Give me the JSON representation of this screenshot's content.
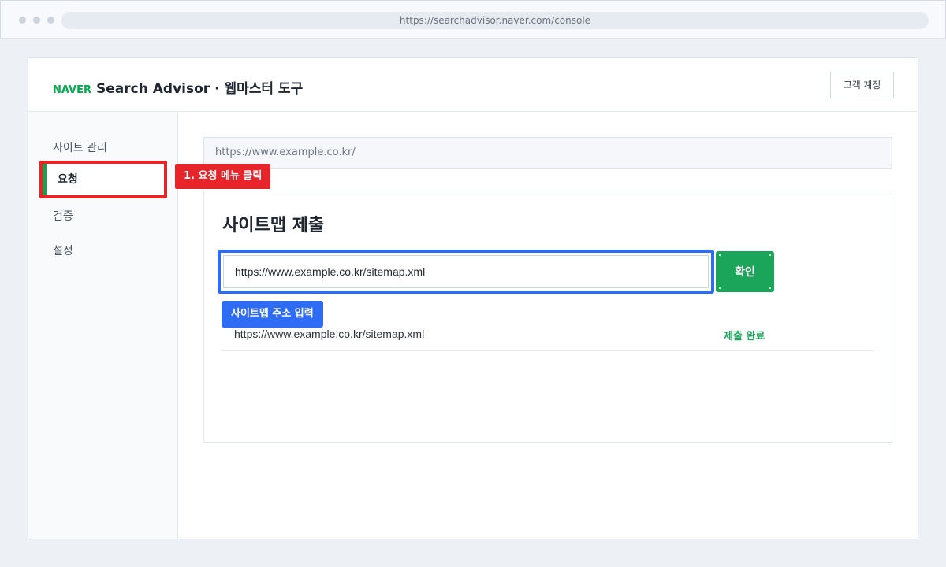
{
  "browser": {
    "url": "https://searchadvisor.naver.com/console"
  },
  "header": {
    "brand": "NAVER",
    "title": "Search Advisor · 웹마스터 도구",
    "account_button": "고객 계정"
  },
  "sidebar": {
    "items": [
      {
        "label": "사이트 관리"
      },
      {
        "label": "요청"
      },
      {
        "label": "검증"
      },
      {
        "label": "설정"
      }
    ],
    "active_index": 1
  },
  "annotations": {
    "step1": "1. 요청 메뉴 클릭",
    "input_hint": "사이트맵 주소 입력"
  },
  "main": {
    "site_url": "https://www.example.co.kr/",
    "card_title": "사이트맵 제출",
    "sitemap_input_value": "https://www.example.co.kr/sitemap.xml",
    "confirm_button": "확인",
    "results": [
      {
        "url": "https://www.example.co.kr/sitemap.xml",
        "status": "제출 완료"
      }
    ]
  },
  "colors": {
    "naver_green": "#03a94f",
    "button_green": "#1ba55a",
    "highlight_red": "#e8242b",
    "highlight_blue": "#2f6cf6"
  }
}
